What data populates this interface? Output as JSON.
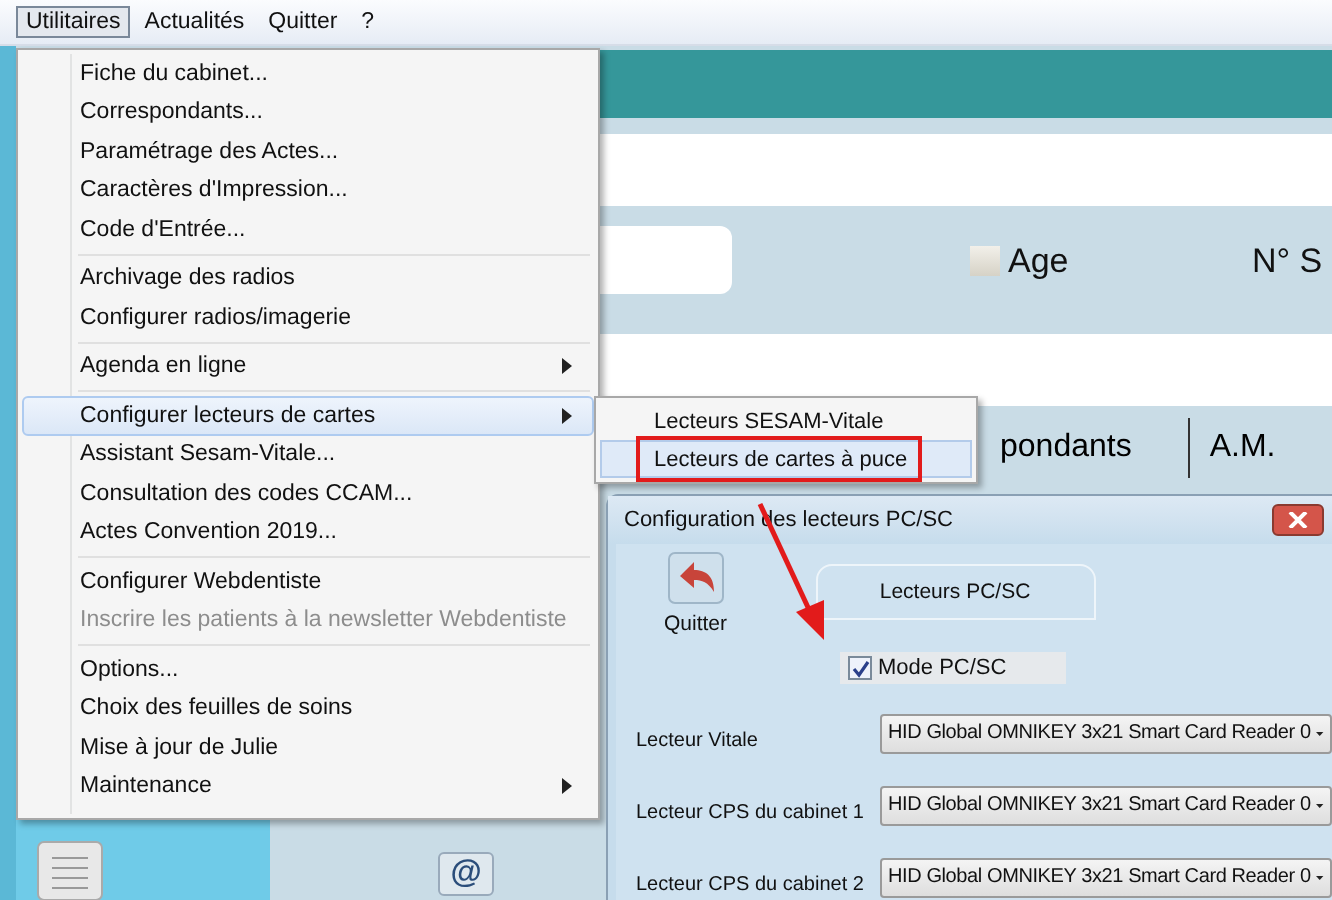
{
  "menubar": [
    {
      "label": "Utilitaires",
      "selected": true
    },
    {
      "label": "Actualités",
      "selected": false
    },
    {
      "label": "Quitter",
      "selected": false
    },
    {
      "label": "?",
      "selected": false
    }
  ],
  "menu": {
    "groups": [
      {
        "items": [
          {
            "label": "Fiche du cabinet...",
            "submenu": false,
            "disabled": false,
            "selected": false
          },
          {
            "label": "Correspondants...",
            "submenu": false,
            "disabled": false,
            "selected": false
          },
          {
            "label": "Paramétrage des Actes...",
            "submenu": false,
            "disabled": false,
            "selected": false
          },
          {
            "label": "Caractères d'Impression...",
            "submenu": false,
            "disabled": false,
            "selected": false
          },
          {
            "label": "Code d'Entrée...",
            "submenu": false,
            "disabled": false,
            "selected": false
          }
        ]
      },
      {
        "items": [
          {
            "label": "Archivage des radios",
            "submenu": false,
            "disabled": false,
            "selected": false
          },
          {
            "label": "Configurer radios/imagerie",
            "submenu": false,
            "disabled": false,
            "selected": false
          }
        ]
      },
      {
        "items": [
          {
            "label": "Agenda en ligne",
            "submenu": true,
            "disabled": false,
            "selected": false
          }
        ]
      },
      {
        "items": [
          {
            "label": "Configurer lecteurs de cartes",
            "submenu": true,
            "disabled": false,
            "selected": true
          },
          {
            "label": "Assistant Sesam-Vitale...",
            "submenu": false,
            "disabled": false,
            "selected": false
          },
          {
            "label": "Consultation des codes CCAM...",
            "submenu": false,
            "disabled": false,
            "selected": false
          },
          {
            "label": "Actes Convention 2019...",
            "submenu": false,
            "disabled": false,
            "selected": false
          }
        ]
      },
      {
        "items": [
          {
            "label": "Configurer Webdentiste",
            "submenu": false,
            "disabled": false,
            "selected": false
          },
          {
            "label": "Inscrire les patients à la newsletter Webdentiste",
            "submenu": false,
            "disabled": true,
            "selected": false
          }
        ]
      },
      {
        "items": [
          {
            "label": "Options...",
            "submenu": false,
            "disabled": false,
            "selected": false
          },
          {
            "label": "Choix des feuilles de soins",
            "submenu": false,
            "disabled": false,
            "selected": false
          },
          {
            "label": "Mise à jour de Julie",
            "submenu": false,
            "disabled": false,
            "selected": false
          },
          {
            "label": "Maintenance",
            "submenu": true,
            "disabled": false,
            "selected": false
          }
        ]
      }
    ]
  },
  "submenu": {
    "items": [
      {
        "label": "Lecteurs SESAM-Vitale",
        "selected": false
      },
      {
        "label": "Lecteurs de cartes à puce",
        "selected": true
      }
    ]
  },
  "background": {
    "age": {
      "label": "Age",
      "checked": false
    },
    "ssn_label": "N° S",
    "email_symbol": "@",
    "tabs": [
      {
        "label": "pondants"
      },
      {
        "label": "A.M."
      }
    ]
  },
  "dialog": {
    "title": "Configuration des lecteurs PC/SC",
    "quit_label": "Quitter",
    "group_label": "Lecteurs PC/SC",
    "mode": {
      "label": "Mode PC/SC",
      "checked": true
    },
    "readers": [
      {
        "label": "Lecteur Vitale",
        "value": "HID Global OMNIKEY 3x21 Smart Card Reader 0"
      },
      {
        "label": "Lecteur CPS du cabinet 1",
        "value": "HID Global OMNIKEY 3x21 Smart Card Reader 0"
      },
      {
        "label": "Lecteur CPS du cabinet 2",
        "value": "HID Global OMNIKEY 3x21 Smart Card Reader 0"
      }
    ]
  }
}
